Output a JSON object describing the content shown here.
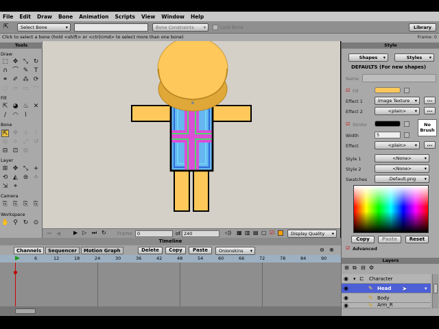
{
  "menu": [
    "File",
    "Edit",
    "Draw",
    "Bone",
    "Animation",
    "Scripts",
    "View",
    "Window",
    "Help"
  ],
  "toolbar": {
    "bone_select": "Select Bone",
    "bone_constraints": "Bone Constraints",
    "lock_bone": "Lock Bone",
    "library": "Library"
  },
  "status": {
    "message": "Click to select a bone (hold <shift> or <ctrl/cmd> to select more than one bone)",
    "frame_readout": "Frame: 0"
  },
  "tools": {
    "title": "Tools",
    "sections": {
      "draw": "Draw",
      "fill": "Fill",
      "bone": "Bone",
      "layer": "Layer",
      "camera": "Camera",
      "workspace": "Workspace"
    }
  },
  "nav": {
    "frame_label": "Frame",
    "frame_value": "0",
    "of_label": "of",
    "total_frames": "240",
    "display_quality": "Display Quality"
  },
  "timeline": {
    "title": "Timeline",
    "tabs": [
      "Channels",
      "Sequencer",
      "Motion Graph"
    ],
    "buttons": [
      "Delete",
      "Copy",
      "Paste"
    ],
    "onionskins": "Onionskins",
    "ruler": [
      "6",
      "12",
      "18",
      "24",
      "30",
      "36",
      "42",
      "48",
      "54",
      "60",
      "66",
      "72",
      "78",
      "84",
      "90"
    ]
  },
  "style": {
    "title": "Style",
    "shapes": "Shapes",
    "styles": "Styles",
    "defaults": "DEFAULTS (For new shapes)",
    "name_label": "Name",
    "fill_label": "Fill",
    "fill_color": "#FFC85A",
    "effect1_label": "Effect 1",
    "effect1_value": "Image Texture",
    "effect2_label": "Effect 2",
    "effect2_value": "<plain>",
    "stroke_label": "Stroke",
    "stroke_color": "#000000",
    "no_brush": "No Brush",
    "width_label": "Width",
    "width_value": "5",
    "effect_label": "Effect",
    "effect_value": "<plain>",
    "style1_label": "Style 1",
    "style1_value": "<None>",
    "style2_label": "Style 2",
    "style2_value": "<None>",
    "swatches_label": "Swatches",
    "swatches_value": ".Default.png",
    "copy": "Copy",
    "paste": "Paste",
    "reset": "Reset",
    "advanced": "Advanced",
    "dots": "..."
  },
  "layers": {
    "title": "Layers",
    "items": [
      "Character",
      "Head",
      "Body",
      "Arm_R"
    ]
  }
}
